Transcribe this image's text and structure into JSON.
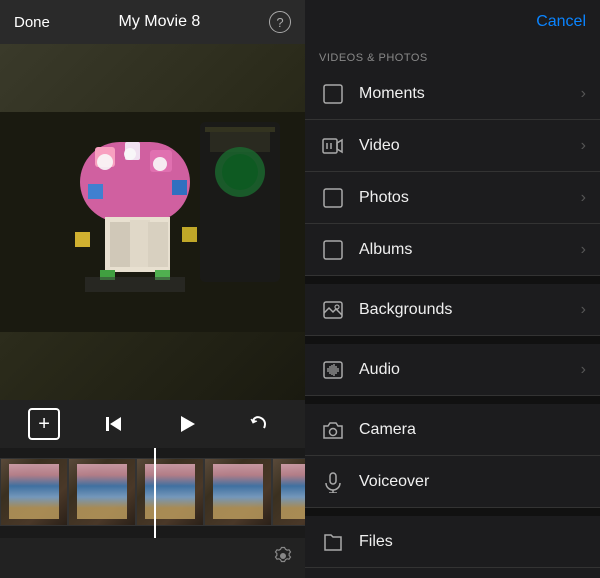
{
  "left": {
    "done_label": "Done",
    "title": "My Movie 8",
    "help_label": "?",
    "controls": {
      "add_label": "+",
      "skip_back": "⏮",
      "play": "▶",
      "undo": "↩"
    },
    "bottom": {
      "gear_label": "⚙"
    }
  },
  "right": {
    "cancel_label": "Cancel",
    "section_label": "VIDEOS & PHOTOS",
    "items": [
      {
        "id": "moments",
        "label": "Moments",
        "icon": "square",
        "has_chevron": true
      },
      {
        "id": "video",
        "label": "Video",
        "icon": "film",
        "has_chevron": true
      },
      {
        "id": "photos",
        "label": "Photos",
        "icon": "square",
        "has_chevron": true
      },
      {
        "id": "albums",
        "label": "Albums",
        "icon": "square",
        "has_chevron": true
      },
      {
        "id": "backgrounds",
        "label": "Backgrounds",
        "icon": "image",
        "has_chevron": true
      },
      {
        "id": "audio",
        "label": "Audio",
        "icon": "music",
        "has_chevron": true
      },
      {
        "id": "camera",
        "label": "Camera",
        "icon": "camera",
        "has_chevron": false
      },
      {
        "id": "voiceover",
        "label": "Voiceover",
        "icon": "mic",
        "has_chevron": false
      },
      {
        "id": "files",
        "label": "Files",
        "icon": "folder",
        "has_chevron": false
      }
    ]
  }
}
